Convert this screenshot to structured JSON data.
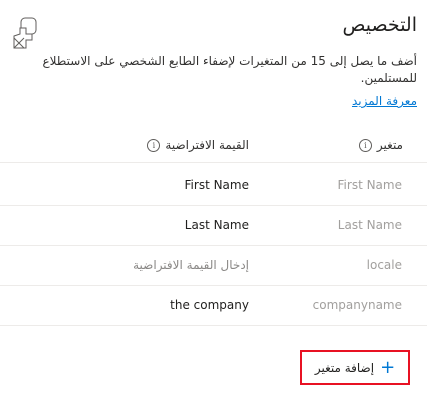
{
  "panel": {
    "title": "التخصيص",
    "description": "أضف ما يصل إلى 15 من المتغيرات لإضفاء الطابع الشخصي على الاستطلاع للمستلمين.",
    "learn_more": "معرفة المزيد",
    "close_icon": "close-icon"
  },
  "table": {
    "headers": {
      "variable": "متغير",
      "default": "القيمة الافتراضية"
    },
    "rows": [
      {
        "variable": "First Name",
        "default": "First Name"
      },
      {
        "variable": "Last Name",
        "default": "Last Name"
      },
      {
        "variable": "locale",
        "default_placeholder": "إدخال القيمة الافتراضية"
      },
      {
        "variable": "companyname",
        "default": "the company"
      }
    ]
  },
  "add_variable": {
    "label": "إضافة متغير",
    "icon": "plus-icon"
  }
}
